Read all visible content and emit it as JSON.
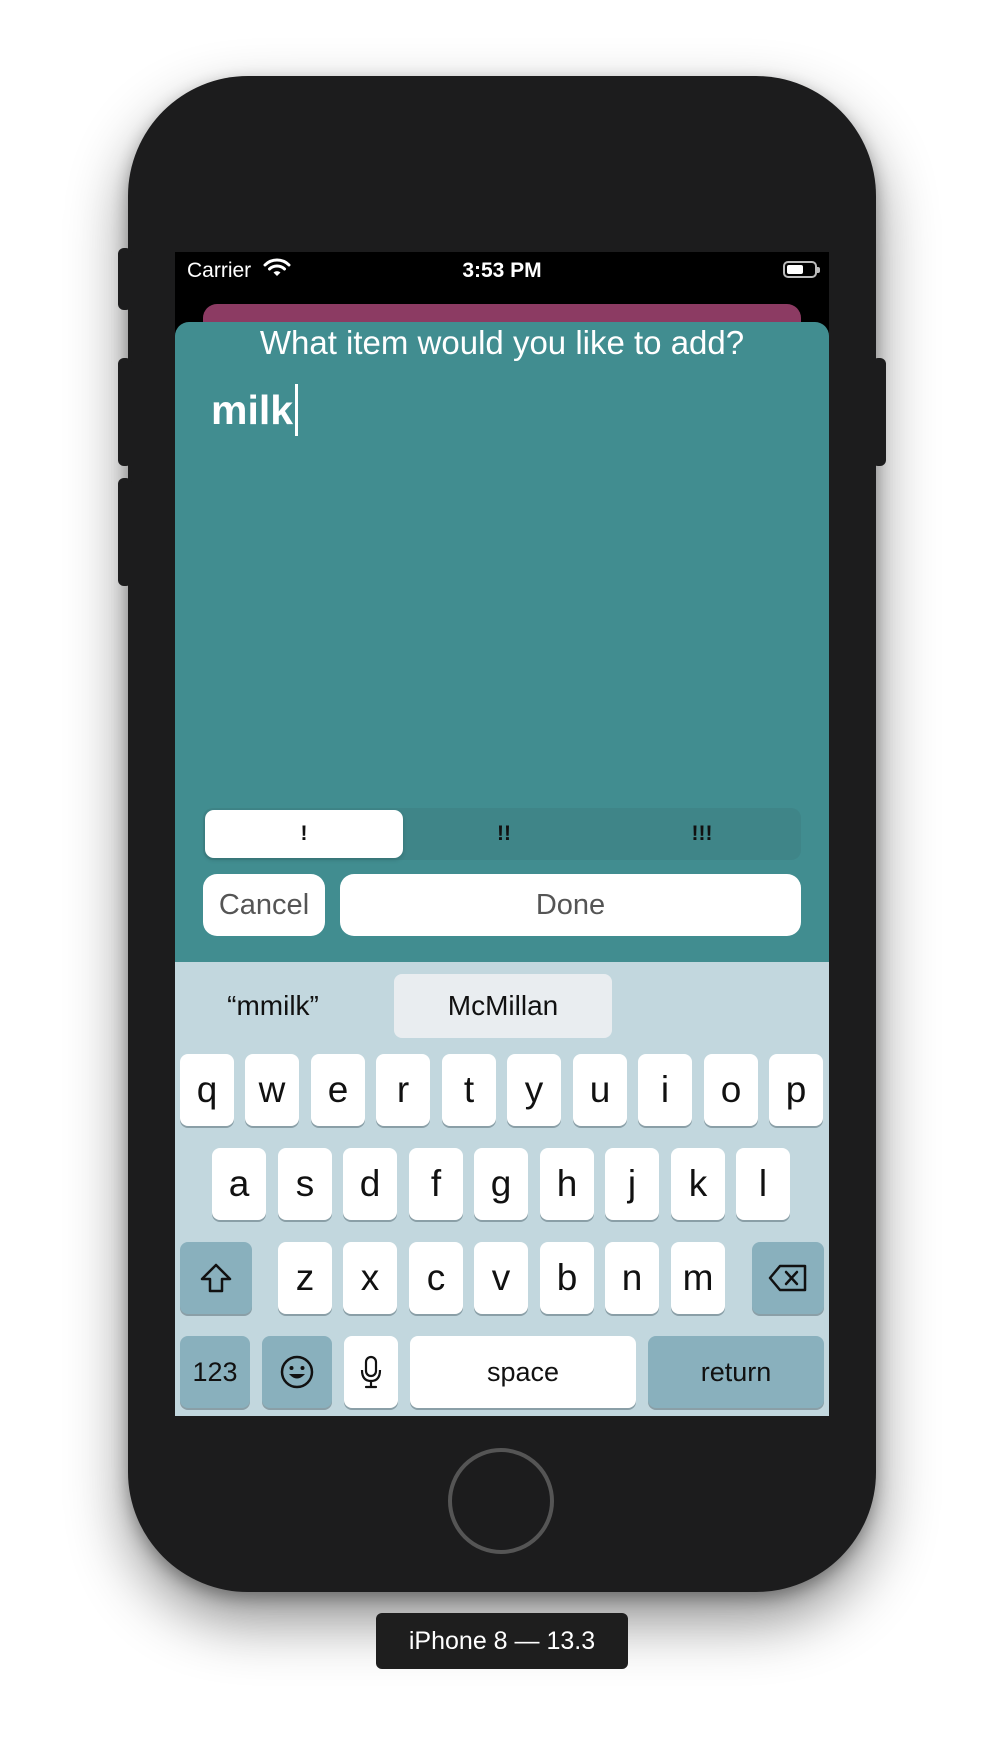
{
  "status_bar": {
    "carrier": "Carrier",
    "time": "3:53 PM",
    "wifi_icon": "wifi-icon",
    "battery_icon": "battery-icon"
  },
  "sheet": {
    "prompt": "What item would you like to add?",
    "input_value": "milk",
    "priority_options": [
      "!",
      "!!",
      "!!!"
    ],
    "priority_selected": "!",
    "cancel_label": "Cancel",
    "done_label": "Done"
  },
  "keyboard": {
    "suggestions": [
      "“mmilk”",
      "McMillan"
    ],
    "row1": [
      "q",
      "w",
      "e",
      "r",
      "t",
      "y",
      "u",
      "i",
      "o",
      "p"
    ],
    "row2": [
      "a",
      "s",
      "d",
      "f",
      "g",
      "h",
      "j",
      "k",
      "l"
    ],
    "row3": [
      "z",
      "x",
      "c",
      "v",
      "b",
      "n",
      "m"
    ],
    "numbers_label": "123",
    "space_label": "space",
    "return_label": "return",
    "shift_icon": "shift-icon",
    "delete_icon": "delete-icon",
    "emoji_icon": "emoji-icon",
    "mic_icon": "microphone-icon"
  },
  "device_label": "iPhone 8 — 13.3",
  "colors": {
    "sheet": "#418d90",
    "background_card": "#8c3b63",
    "keyboard": "#c2d7de",
    "dark_key": "#89b0bd"
  }
}
